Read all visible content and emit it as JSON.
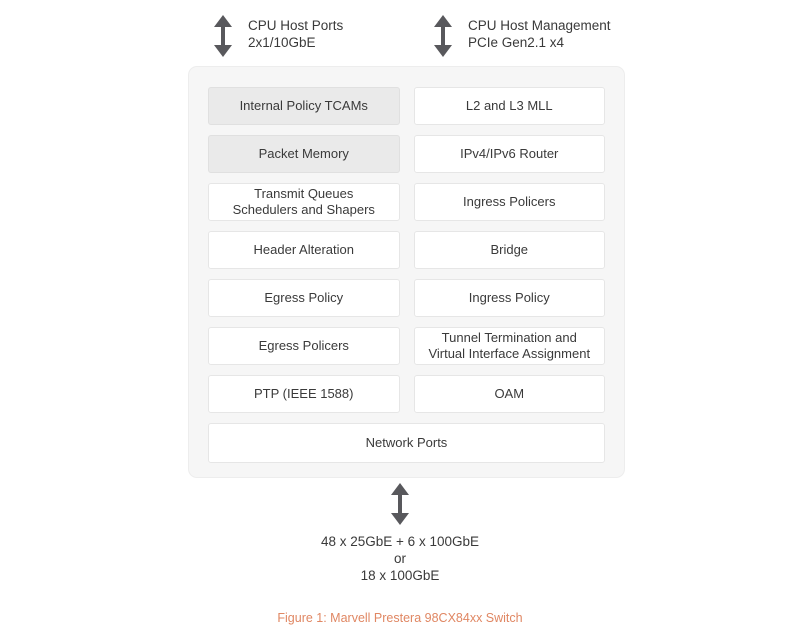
{
  "figure": {
    "caption": "Figure 1: Marvell Prestera 98CX84xx Switch"
  },
  "top_interfaces": [
    {
      "icon": "double-arrow-vertical-icon",
      "line1": "CPU Host Ports",
      "line2": "2x1/10GbE"
    },
    {
      "icon": "double-arrow-vertical-icon",
      "line1": "CPU Host Management",
      "line2": "PCIe Gen2.1 x4"
    }
  ],
  "chip": {
    "rows": [
      {
        "left": {
          "line1": "Internal Policy TCAMs",
          "line2": "",
          "shaded": true
        },
        "right": {
          "line1": "L2 and L3 MLL",
          "line2": "",
          "shaded": false
        }
      },
      {
        "left": {
          "line1": "Packet Memory",
          "line2": "",
          "shaded": true
        },
        "right": {
          "line1": "IPv4/IPv6 Router",
          "line2": "",
          "shaded": false
        }
      },
      {
        "left": {
          "line1": "Transmit Queues",
          "line2": "Schedulers and Shapers",
          "shaded": false
        },
        "right": {
          "line1": "Ingress Policers",
          "line2": "",
          "shaded": false
        }
      },
      {
        "left": {
          "line1": "Header Alteration",
          "line2": "",
          "shaded": false
        },
        "right": {
          "line1": "Bridge",
          "line2": "",
          "shaded": false
        }
      },
      {
        "left": {
          "line1": "Egress Policy",
          "line2": "",
          "shaded": false
        },
        "right": {
          "line1": "Ingress Policy",
          "line2": "",
          "shaded": false
        }
      },
      {
        "left": {
          "line1": "Egress Policers",
          "line2": "",
          "shaded": false
        },
        "right": {
          "line1": "Tunnel Termination and",
          "line2": "Virtual Interface Assignment",
          "shaded": false
        }
      },
      {
        "left": {
          "line1": "PTP (IEEE 1588)",
          "line2": "",
          "shaded": false
        },
        "right": {
          "line1": "OAM",
          "line2": "",
          "shaded": false
        }
      }
    ],
    "full_width_block": {
      "line1": "Network Ports"
    }
  },
  "bottom_interface": {
    "icon": "double-arrow-vertical-icon",
    "line1": "48 x 25GbE + 6 x 100GbE",
    "line2": "or",
    "line3": "18 x 100GbE"
  },
  "colors": {
    "page_background": "#ffffff",
    "chip_background": "#f6f6f6",
    "block_background": "#ffffff",
    "block_shaded_background": "#eaeaea",
    "text": "#3a3a3a",
    "arrow": "#58585c",
    "caption": "#e08763"
  }
}
